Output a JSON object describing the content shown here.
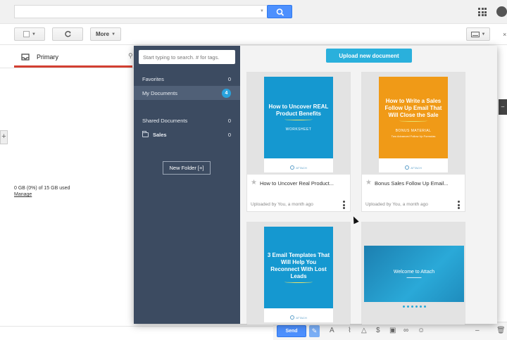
{
  "colors": {
    "gmail_blue": "#4d90fe",
    "sidebar_bg": "#3c4b61",
    "accent_cyan": "#2ab0dc",
    "cover_blue": "#1598d0",
    "cover_orange": "#f09a17"
  },
  "gmail": {
    "search": {
      "value": "",
      "icon": "search-icon"
    },
    "toolbar": {
      "more_label": "More",
      "refresh_icon": "refresh-icon"
    },
    "tabs": {
      "primary_label": "Primary"
    },
    "storage": {
      "usage_text": "0 GB (0%) of 15 GB used",
      "manage_label": "Manage"
    },
    "compose": {
      "send_label": "Send"
    }
  },
  "attach_panel": {
    "search_placeholder": "Start typing to search. # for tags.",
    "upload_label": "Upload new document",
    "nav": [
      {
        "label": "Favorites",
        "count": "0"
      },
      {
        "label": "My Documents",
        "count": "4",
        "active": true
      },
      {
        "label": "Shared Documents",
        "count": "0"
      },
      {
        "label": "Sales",
        "count": "0"
      }
    ],
    "new_folder_label": "New Folder [+]",
    "documents": [
      {
        "title": "How to Uncover Real Product...",
        "meta": "Uploaded by You, a month ago",
        "cover_title": "How to Uncover REAL Product Benefits",
        "cover_subtitle": "WORKSHEET",
        "logo_text": "ATTACH"
      },
      {
        "title": "Bonus Sales Follow Up Email...",
        "meta": "Uploaded by You, a month ago",
        "cover_title": "How to Write a Sales Follow Up Email That Will Close the Sale",
        "cover_subtitle": "BONUS MATERIAL",
        "cover_small": "Two Advanced Follow Up Formulas",
        "logo_text": "ATTACH"
      },
      {
        "cover_title": "3 Email Templates That Will Help You Reconnect With Lost Leads",
        "logo_text": "ATTACH"
      },
      {
        "cover_title": "Welcome to Attach"
      }
    ]
  }
}
